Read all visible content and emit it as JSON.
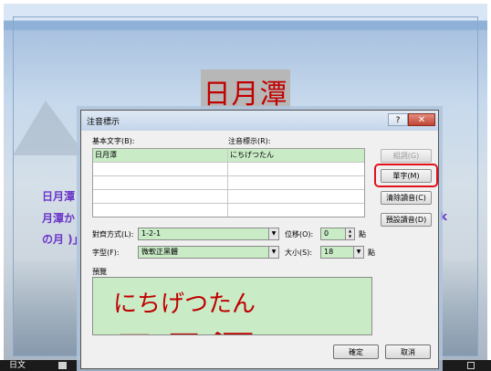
{
  "slide": {
    "title": "日月潭",
    "text_line1_left": "日月潭",
    "text_line2_left": "月潭か",
    "text_line3_left": "の月 )」",
    "text_right_k": "k"
  },
  "statusbar": {
    "language": "日文"
  },
  "dialog": {
    "title": "注音標示",
    "help_label": "?",
    "close_label": "✕",
    "base_text_label": "基本文字(B):",
    "ruby_text_label": "注音標示(R):",
    "rows": [
      {
        "base": "日月潭",
        "ruby": "にちげつたん"
      },
      {
        "base": "",
        "ruby": ""
      },
      {
        "base": "",
        "ruby": ""
      },
      {
        "base": "",
        "ruby": ""
      },
      {
        "base": "",
        "ruby": ""
      }
    ],
    "btn_group": "組詞(G)",
    "btn_mono": "單字(M)",
    "btn_clear": "清除讀音(C)",
    "btn_default": "預設讀音(D)",
    "alignment_label": "對齊方式(L):",
    "alignment_value": "1-2-1",
    "offset_label": "位移(O):",
    "offset_value": "0",
    "offset_unit": "點",
    "font_label": "字型(F):",
    "font_value": "微軟正黑體",
    "size_label": "大小(S):",
    "size_value": "18",
    "size_unit": "點",
    "preview_label": "預覽",
    "preview_ruby": "にちげつたん",
    "preview_base": "日月潭",
    "ok_label": "確定",
    "cancel_label": "取消"
  },
  "colors": {
    "highlight": "#e0101a",
    "field_bg": "#c9ecc7",
    "title_red": "#c00000"
  }
}
